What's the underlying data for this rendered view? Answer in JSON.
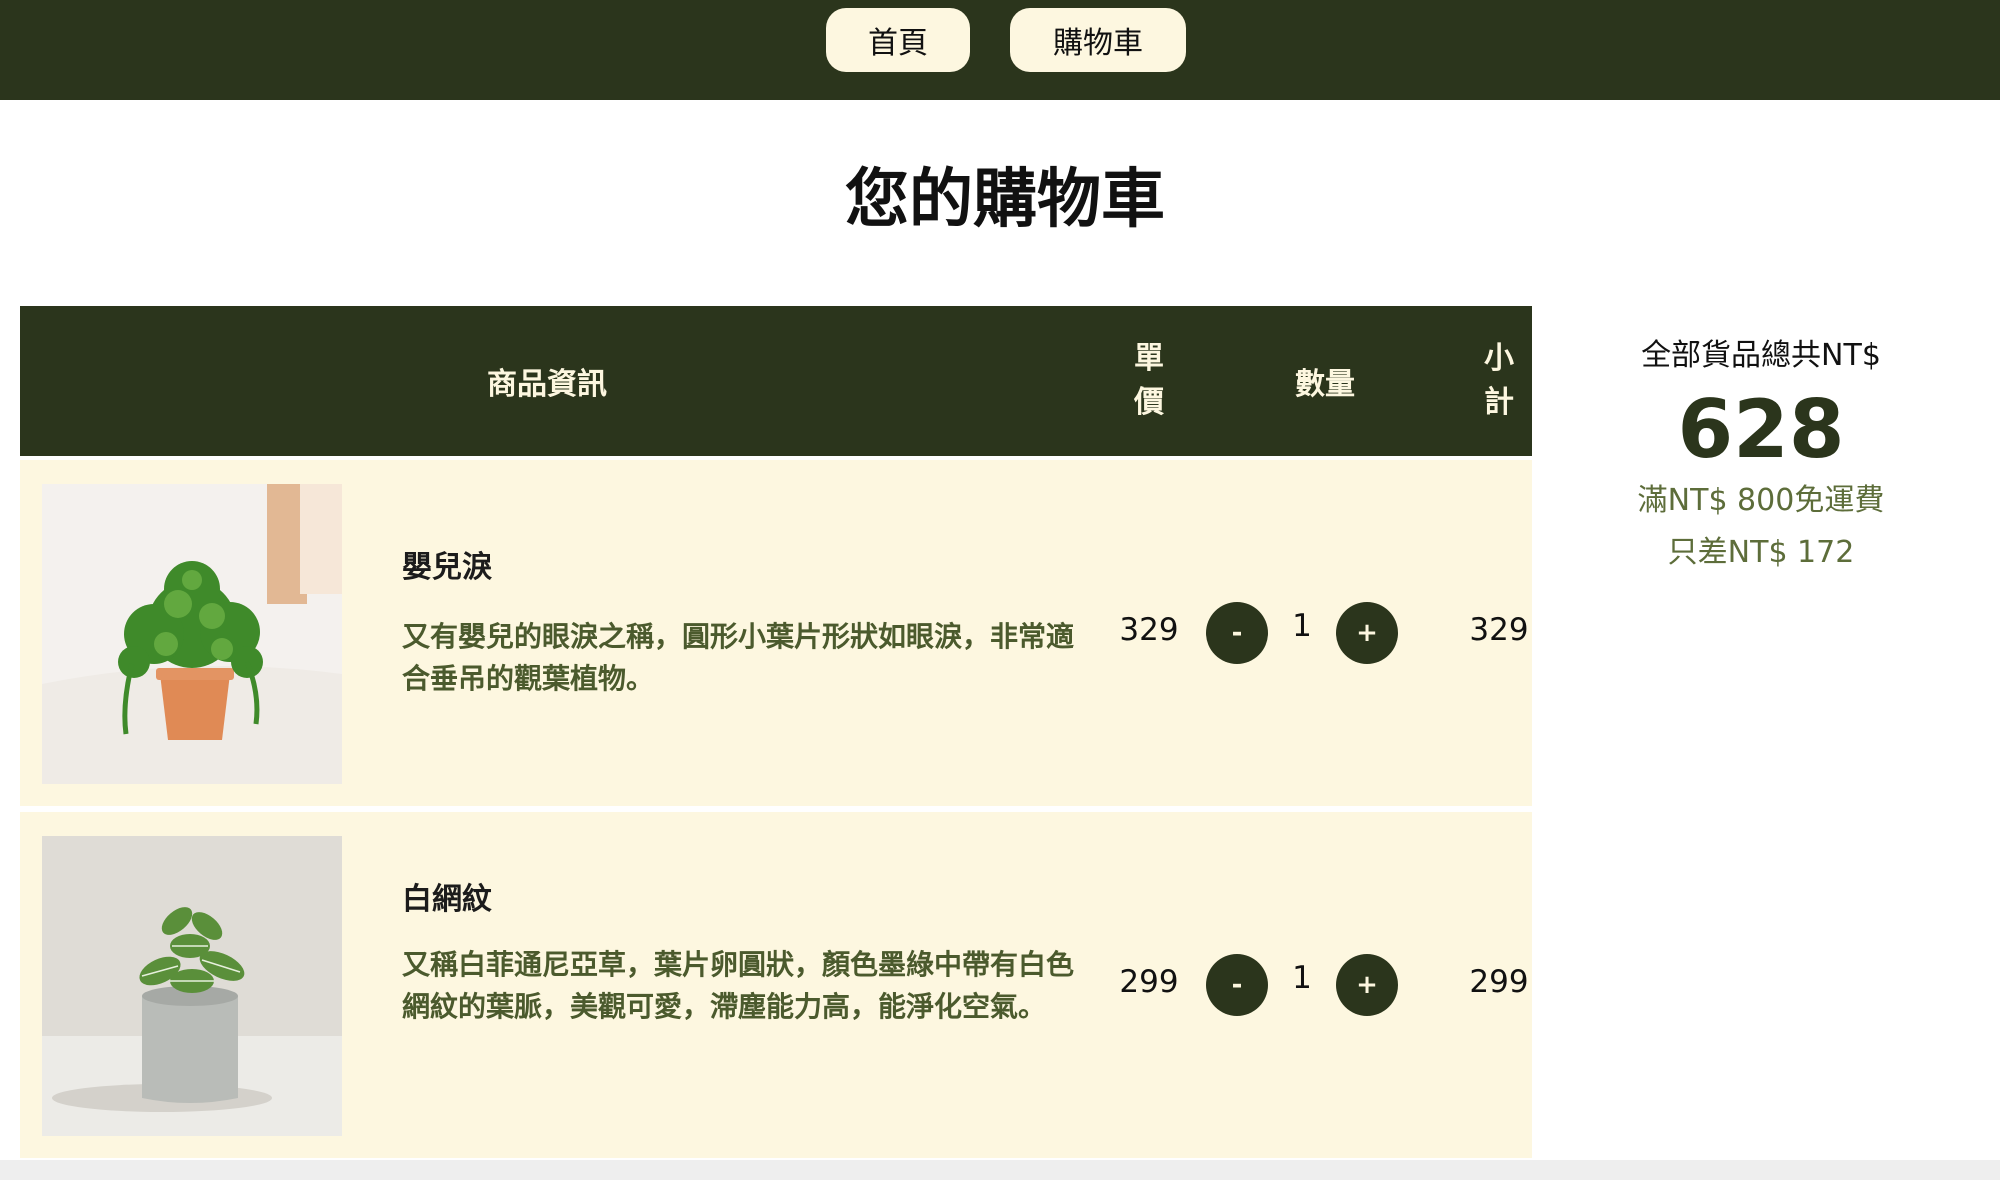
{
  "nav": {
    "home_label": "首頁",
    "cart_label": "購物車"
  },
  "page": {
    "title": "您的購物車"
  },
  "table": {
    "headers": {
      "info": "商品資訊",
      "price_line1": "單",
      "price_line2": "價",
      "qty": "數量",
      "subtotal_line1": "小",
      "subtotal_line2": "計"
    }
  },
  "items": [
    {
      "name": "嬰兒淚",
      "description": "又有嬰兒的眼淚之稱，圓形小葉片形狀如眼淚，非常適合垂吊的觀葉植物。",
      "price": "329",
      "quantity": "1",
      "subtotal": "329",
      "minus_label": "-",
      "plus_label": "+"
    },
    {
      "name": "白網紋",
      "description": "又稱白菲通尼亞草，葉片卵圓狀，顏色墨綠中帶有白色網紋的葉脈，美觀可愛，滯塵能力高，能淨化空氣。",
      "price": "299",
      "quantity": "1",
      "subtotal": "299",
      "minus_label": "-",
      "plus_label": "+"
    }
  ],
  "summary": {
    "label": "全部貨品總共NT$",
    "total": "628",
    "free_shipping_note": "滿NT$ 800免運費",
    "remaining_note": "只差NT$ 172"
  },
  "colors": {
    "brand_dark_green": "#2b351c",
    "cream": "#fdf7e0",
    "description_green": "#4b5a2d"
  }
}
